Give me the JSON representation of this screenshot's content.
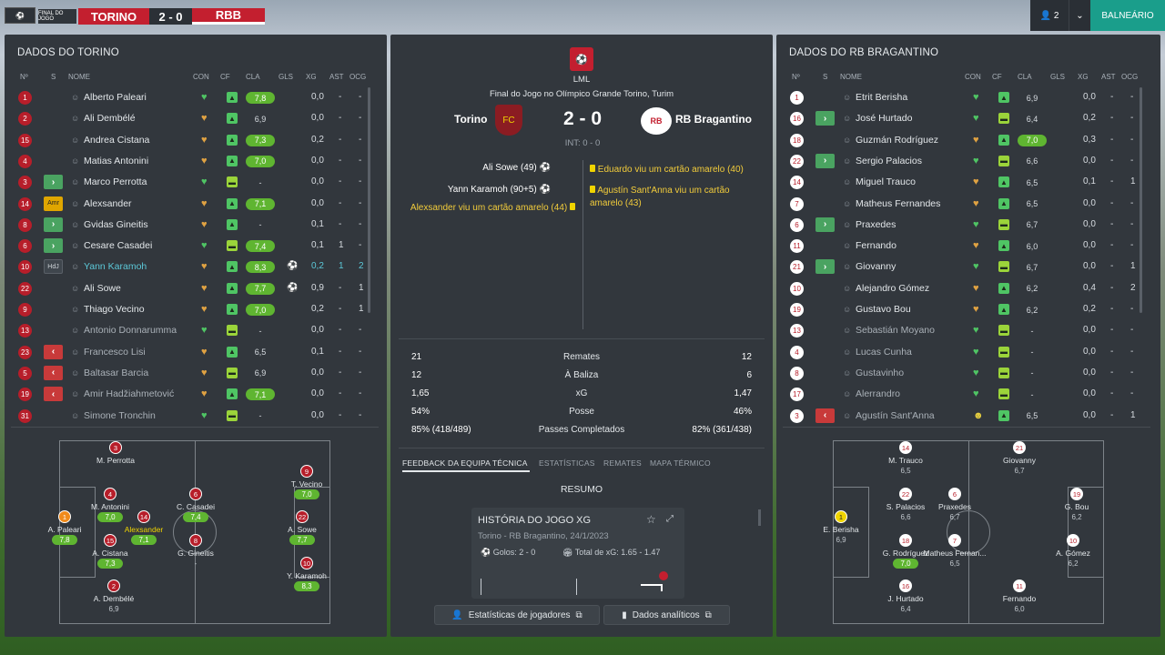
{
  "topbar": {
    "competition_logo": "bundesliga-logo",
    "status": "FINAL DO JOGO",
    "home": "TORINO",
    "score": "2 - 0",
    "away": "RBB",
    "users_count": "2",
    "balneario": "BALNEÁRIO"
  },
  "left_panel": {
    "title": "DADOS DO TORINO",
    "headers": {
      "no": "Nº",
      "s": "S",
      "nome": "NOME",
      "con": "CON",
      "cf": "CF",
      "cla": "CLA",
      "gls": "GLS",
      "xg": "XG",
      "ast": "AST",
      "ocg": "OCG"
    },
    "players": [
      {
        "no": "1",
        "sub": "",
        "name": "Alberto Paleari",
        "con": "green",
        "cla": "7,8",
        "cla_good": true,
        "gls": "",
        "xg": "0,0",
        "ast": "-",
        "ocg": "-",
        "cf": "up"
      },
      {
        "no": "2",
        "sub": "",
        "name": "Ali Dembélé",
        "con": "orange",
        "cla": "6,9",
        "cla_good": false,
        "gls": "",
        "xg": "0,0",
        "ast": "-",
        "ocg": "-",
        "cf": "up"
      },
      {
        "no": "15",
        "sub": "",
        "name": "Andrea Cistana",
        "con": "orange",
        "cla": "7,3",
        "cla_good": true,
        "gls": "",
        "xg": "0,2",
        "ast": "-",
        "ocg": "-",
        "cf": "up"
      },
      {
        "no": "4",
        "sub": "",
        "name": "Matias Antonini",
        "con": "orange",
        "cla": "7,0",
        "cla_good": true,
        "gls": "",
        "xg": "0,0",
        "ast": "-",
        "ocg": "-",
        "cf": "up"
      },
      {
        "no": "3",
        "sub": "in",
        "name": "Marco Perrotta",
        "con": "green",
        "cla": "-",
        "cla_good": false,
        "gls": "",
        "xg": "0,0",
        "ast": "-",
        "ocg": "-",
        "cf": "eq"
      },
      {
        "no": "14",
        "sub": "amr",
        "sub_label": "Amr",
        "name": "Alexsander",
        "con": "orange",
        "cla": "7,1",
        "cla_good": true,
        "gls": "",
        "xg": "0,0",
        "ast": "-",
        "ocg": "-",
        "cf": "up"
      },
      {
        "no": "8",
        "sub": "in",
        "name": "Gvidas Gineitis",
        "con": "orange",
        "cla": "-",
        "cla_good": false,
        "gls": "",
        "xg": "0,1",
        "ast": "-",
        "ocg": "-",
        "cf": "up"
      },
      {
        "no": "6",
        "sub": "in",
        "name": "Cesare Casadei",
        "con": "green",
        "cla": "7,4",
        "cla_good": true,
        "gls": "",
        "xg": "0,1",
        "ast": "1",
        "ocg": "-",
        "cf": "eq"
      },
      {
        "no": "10",
        "sub": "hd",
        "sub_label": "HdJ",
        "name": "Yann Karamoh",
        "con": "orange",
        "cla": "8,3",
        "cla_good": true,
        "gls": "⚽",
        "xg": "0,2",
        "ast": "1",
        "ocg": "2",
        "cf": "up",
        "teal": true
      },
      {
        "no": "22",
        "sub": "",
        "name": "Ali Sowe",
        "con": "orange",
        "cla": "7,7",
        "cla_good": true,
        "gls": "⚽",
        "xg": "0,9",
        "ast": "-",
        "ocg": "1",
        "cf": "up"
      },
      {
        "no": "9",
        "sub": "",
        "name": "Thiago Vecino",
        "con": "orange",
        "cla": "7,0",
        "cla_good": true,
        "gls": "",
        "xg": "0,2",
        "ast": "-",
        "ocg": "1",
        "cf": "up"
      },
      {
        "no": "13",
        "sub": "",
        "name": "Antonio Donnarumma",
        "con": "green",
        "cla": "-",
        "cla_good": false,
        "gls": "",
        "xg": "0,0",
        "ast": "-",
        "ocg": "-",
        "cf": "eq",
        "dim": true
      },
      {
        "no": "23",
        "sub": "out",
        "name": "Francesco Lisi",
        "con": "orange",
        "cla": "6,5",
        "cla_good": false,
        "gls": "",
        "xg": "0,1",
        "ast": "-",
        "ocg": "-",
        "cf": "up",
        "dim": true
      },
      {
        "no": "5",
        "sub": "out",
        "name": "Baltasar Barcia",
        "con": "orange",
        "cla": "6,9",
        "cla_good": false,
        "gls": "",
        "xg": "0,0",
        "ast": "-",
        "ocg": "-",
        "cf": "eq",
        "dim": true
      },
      {
        "no": "19",
        "sub": "out",
        "name": "Amir Hadžiahmetović",
        "con": "orange",
        "cla": "7,1",
        "cla_good": true,
        "gls": "",
        "xg": "0,0",
        "ast": "-",
        "ocg": "-",
        "cf": "up",
        "dim": true
      },
      {
        "no": "31",
        "sub": "",
        "name": "Simone Tronchin",
        "con": "green",
        "cla": "-",
        "cla_good": false,
        "gls": "",
        "xg": "0,0",
        "ast": "-",
        "ocg": "-",
        "cf": "eq",
        "dim": true
      }
    ]
  },
  "left_pitch": [
    {
      "no": "3",
      "name": "M. Perrotta",
      "rating": "",
      "good": false
    },
    {
      "no": "4",
      "name": "M. Antonini",
      "rating": "7,0",
      "good": true
    },
    {
      "no": "1",
      "name": "A. Paleari",
      "rating": "7,8",
      "good": true,
      "dot": "orange"
    },
    {
      "no": "14",
      "name": "Alexsander",
      "rating": "7,1",
      "good": true,
      "yellowname": true
    },
    {
      "no": "15",
      "name": "A. Cistana",
      "rating": "7,3",
      "good": true
    },
    {
      "no": "2",
      "name": "A. Dembélé",
      "rating": "6,9",
      "good": false
    },
    {
      "no": "6",
      "name": "C. Casadei",
      "rating": "7,4",
      "good": true
    },
    {
      "no": "8",
      "name": "G. Gineitis",
      "rating": "-",
      "good": false
    },
    {
      "no": "9",
      "name": "T. Vecino",
      "rating": "7,0",
      "good": true
    },
    {
      "no": "22",
      "name": "A. Sowe",
      "rating": "7,7",
      "good": true
    },
    {
      "no": "10",
      "name": "Y. Karamoh",
      "rating": "8,3",
      "good": true
    }
  ],
  "center": {
    "league_short": "LML",
    "match_title": "Final do Jogo no Olímpico Grande Torino, Turim",
    "home_team": "Torino",
    "away_team": "RB Bragantino",
    "score": "2 - 0",
    "halftime": "INT: 0 - 0",
    "events_home": [
      {
        "text": "Ali Sowe (49)",
        "type": "goal"
      },
      {
        "text": "Yann Karamoh (90+5)",
        "type": "goal"
      },
      {
        "text": "Alexsander viu um cartão amarelo (44)",
        "type": "yellow"
      }
    ],
    "events_away": [
      {
        "text": "Eduardo viu um cartão amarelo (40)",
        "type": "yellow"
      },
      {
        "text": "Agustín Sant'Anna viu um cartão amarelo (43)",
        "type": "yellow"
      }
    ],
    "stats": [
      {
        "l": "21",
        "c": "Remates",
        "r": "12"
      },
      {
        "l": "12",
        "c": "À Baliza",
        "r": "6"
      },
      {
        "l": "1,65",
        "c": "xG",
        "r": "1,47"
      },
      {
        "l": "54%",
        "c": "Posse",
        "r": "46%"
      },
      {
        "l": "85% (418/489)",
        "c": "Passes Completados",
        "r": "82% (361/438)"
      }
    ],
    "tabs": [
      "FEEDBACK DA EQUIPA TÉCNICA",
      "ESTATÍSTICAS",
      "REMATES",
      "MAPA TÉRMICO"
    ],
    "summary_title": "RESUMO",
    "card_title": "HISTÓRIA DO JOGO XG",
    "card_subtitle": "Torino - RB Bragantino, 24/1/2023",
    "card_goals": "Golos: 2 - 0",
    "card_xg": "Total de xG: 1.65 - 1.47",
    "btn_players": "Estatísticas de jogadores",
    "btn_analytics": "Dados analíticos"
  },
  "right_panel": {
    "title": "DADOS DO RB BRAGANTINO",
    "players": [
      {
        "no": "1",
        "sub": "",
        "name": "Etrit Berisha",
        "con": "green",
        "cla": "6,9",
        "cla_good": false,
        "xg": "0,0",
        "ast": "-",
        "ocg": "-",
        "cf": "up"
      },
      {
        "no": "16",
        "sub": "in",
        "name": "José Hurtado",
        "con": "green",
        "cla": "6,4",
        "cla_good": false,
        "xg": "0,2",
        "ast": "-",
        "ocg": "-",
        "cf": "eq"
      },
      {
        "no": "18",
        "sub": "",
        "name": "Guzmán Rodríguez",
        "con": "orange",
        "cla": "7,0",
        "cla_good": true,
        "xg": "0,3",
        "ast": "-",
        "ocg": "-",
        "cf": "up"
      },
      {
        "no": "22",
        "sub": "in",
        "name": "Sergio Palacios",
        "con": "green",
        "cla": "6,6",
        "cla_good": false,
        "xg": "0,0",
        "ast": "-",
        "ocg": "-",
        "cf": "eq"
      },
      {
        "no": "14",
        "sub": "",
        "name": "Miguel Trauco",
        "con": "orange",
        "cla": "6,5",
        "cla_good": false,
        "xg": "0,1",
        "ast": "-",
        "ocg": "1",
        "cf": "up"
      },
      {
        "no": "7",
        "sub": "",
        "name": "Matheus Fernandes",
        "con": "orange",
        "cla": "6,5",
        "cla_good": false,
        "xg": "0,0",
        "ast": "-",
        "ocg": "-",
        "cf": "up"
      },
      {
        "no": "6",
        "sub": "in",
        "name": "Praxedes",
        "con": "green",
        "cla": "6,7",
        "cla_good": false,
        "xg": "0,0",
        "ast": "-",
        "ocg": "-",
        "cf": "eq"
      },
      {
        "no": "11",
        "sub": "",
        "name": "Fernando",
        "con": "orange",
        "cla": "6,0",
        "cla_good": false,
        "xg": "0,0",
        "ast": "-",
        "ocg": "-",
        "cf": "up"
      },
      {
        "no": "21",
        "sub": "in",
        "name": "Giovanny",
        "con": "green",
        "cla": "6,7",
        "cla_good": false,
        "xg": "0,0",
        "ast": "-",
        "ocg": "1",
        "cf": "eq"
      },
      {
        "no": "10",
        "sub": "",
        "name": "Alejandro Gómez",
        "con": "orange",
        "cla": "6,2",
        "cla_good": false,
        "xg": "0,4",
        "ast": "-",
        "ocg": "2",
        "cf": "up"
      },
      {
        "no": "19",
        "sub": "",
        "name": "Gustavo Bou",
        "con": "orange",
        "cla": "6,2",
        "cla_good": false,
        "xg": "0,2",
        "ast": "-",
        "ocg": "-",
        "cf": "up"
      },
      {
        "no": "13",
        "sub": "",
        "name": "Sebastián Moyano",
        "con": "green",
        "cla": "-",
        "cla_good": false,
        "xg": "0,0",
        "ast": "-",
        "ocg": "-",
        "cf": "eq",
        "dim": true
      },
      {
        "no": "4",
        "sub": "",
        "name": "Lucas Cunha",
        "con": "green",
        "cla": "-",
        "cla_good": false,
        "xg": "0,0",
        "ast": "-",
        "ocg": "-",
        "cf": "eq",
        "dim": true
      },
      {
        "no": "8",
        "sub": "",
        "name": "Gustavinho",
        "con": "green",
        "cla": "-",
        "cla_good": false,
        "xg": "0,0",
        "ast": "-",
        "ocg": "-",
        "cf": "eq",
        "dim": true
      },
      {
        "no": "17",
        "sub": "",
        "name": "Alerrandro",
        "con": "green",
        "cla": "-",
        "cla_good": false,
        "xg": "0,0",
        "ast": "-",
        "ocg": "-",
        "cf": "eq",
        "dim": true
      },
      {
        "no": "3",
        "sub": "out",
        "name": "Agustín Sant'Anna",
        "con": "yellow",
        "cla": "6,5",
        "cla_good": false,
        "xg": "0,0",
        "ast": "-",
        "ocg": "1",
        "cf": "up",
        "dim": true
      }
    ]
  },
  "right_pitch": [
    {
      "no": "14",
      "name": "M. Trauco",
      "rating": "6,5"
    },
    {
      "no": "21",
      "name": "Giovanny",
      "rating": "6,7"
    },
    {
      "no": "22",
      "name": "S. Palacios",
      "rating": "6,6"
    },
    {
      "no": "6",
      "name": "Praxedes",
      "rating": "6,7"
    },
    {
      "no": "1",
      "name": "E. Berisha",
      "rating": "6,9",
      "dot": "yellow"
    },
    {
      "no": "18",
      "name": "G. Rodríguez",
      "rating": "7,0",
      "good": true
    },
    {
      "no": "7",
      "name": "Matheus Fernan...",
      "rating": "6,5"
    },
    {
      "no": "19",
      "name": "G. Bou",
      "rating": "6,2"
    },
    {
      "no": "10",
      "name": "A. Gómez",
      "rating": "6,2"
    },
    {
      "no": "16",
      "name": "J. Hurtado",
      "rating": "6,4"
    },
    {
      "no": "11",
      "name": "Fernando",
      "rating": "6,0"
    }
  ]
}
